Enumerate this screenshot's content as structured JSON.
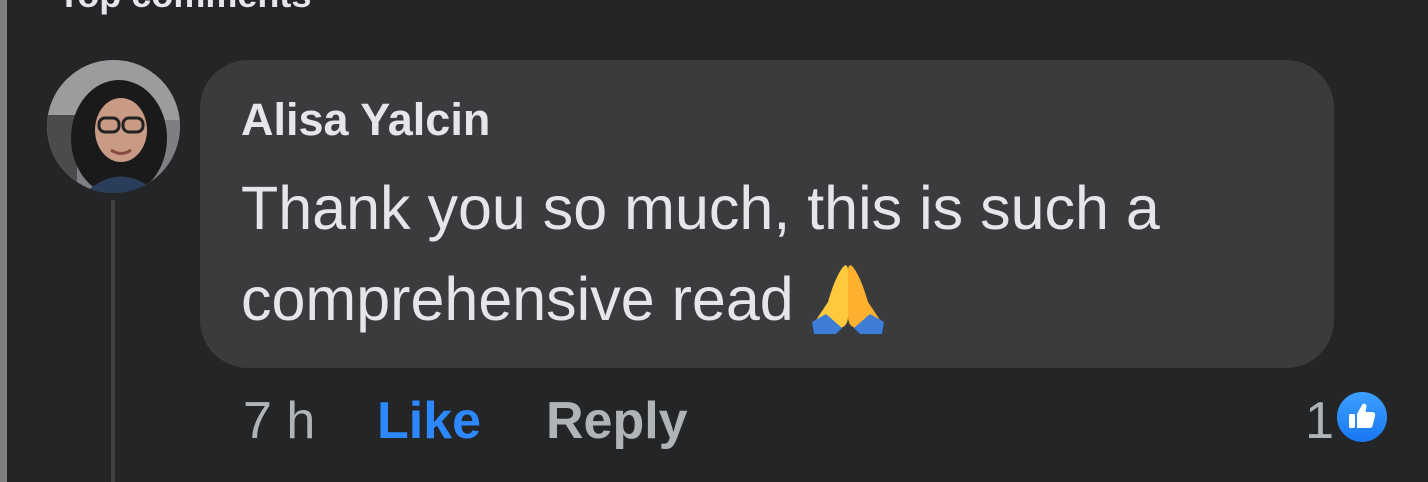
{
  "section": {
    "heading": "Top comments"
  },
  "comment": {
    "author": "Alisa Yalcin",
    "text": "Thank you so much, this is such a comprehensive read",
    "emoji": "folded-hands",
    "timestamp": "7 h",
    "like_label": "Like",
    "reply_label": "Reply",
    "reaction_count": "1",
    "reaction_icon": "thumbs-up-icon"
  },
  "colors": {
    "background": "#242526",
    "bubble": "#3a3b3c",
    "primary_text": "#e4e6eb",
    "secondary_text": "#b0b3b8",
    "like_blue": "#2d88ff"
  }
}
